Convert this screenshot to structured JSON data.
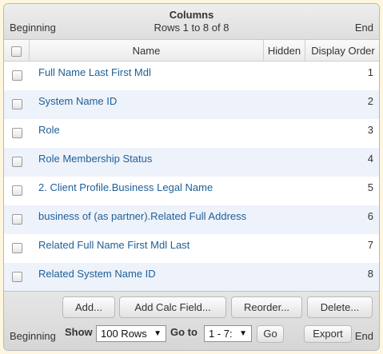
{
  "top": {
    "title": "Columns",
    "subtitle": "Rows 1 to 8 of 8",
    "left": "Beginning",
    "right": "End"
  },
  "headers": {
    "name": "Name",
    "hidden": "Hidden",
    "order": "Display Order"
  },
  "rows": [
    {
      "name": "Full Name Last First Mdl",
      "order": "1"
    },
    {
      "name": "System Name ID",
      "order": "2"
    },
    {
      "name": "Role",
      "order": "3"
    },
    {
      "name": "Role Membership Status",
      "order": "4"
    },
    {
      "name": "2. Client Profile.Business Legal Name",
      "order": "5"
    },
    {
      "name": "business of (as partner).Related Full Address",
      "order": "6"
    },
    {
      "name": "Related Full Name First Mdl Last",
      "order": "7"
    },
    {
      "name": "Related System Name ID",
      "order": "8"
    }
  ],
  "buttons": {
    "add": "Add...",
    "add_calc": "Add Calc Field...",
    "reorder": "Reorder...",
    "delete": "Delete...",
    "go": "Go",
    "export": "Export"
  },
  "footer": {
    "left": "Beginning",
    "right": "End",
    "show_label": "Show",
    "rows_select": "100 Rows",
    "goto_label": "Go to",
    "page_select": "1 - 7:"
  }
}
